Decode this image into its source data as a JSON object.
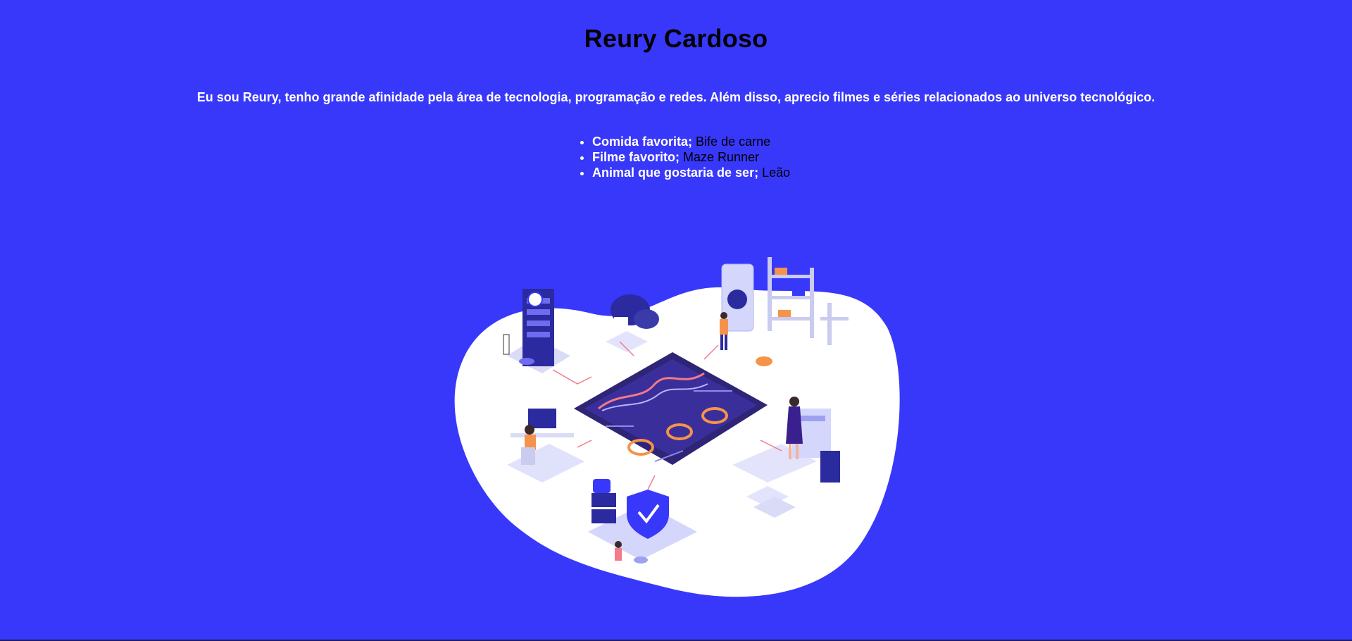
{
  "header": {
    "title": "Reury Cardoso"
  },
  "intro": {
    "text": "Eu sou Reury, tenho grande afinidade pela área de tecnologia, programação e redes. Além disso, aprecio filmes e séries relacionados ao universo tecnológico."
  },
  "facts": [
    {
      "label": "Comida favorita;",
      "value": "Bife de carne"
    },
    {
      "label": "Filme favorito;",
      "value": "Maze Runner"
    },
    {
      "label": "Animal que gostaria de ser;",
      "value": "Leão"
    }
  ],
  "colors": {
    "background": "#3838fb",
    "blob": "#ffffff",
    "board": "#3a2f9a",
    "accent": "#f6934a",
    "pink": "#f27a8a"
  },
  "illustration": {
    "icon": "isometric-tech-network-illustration"
  }
}
